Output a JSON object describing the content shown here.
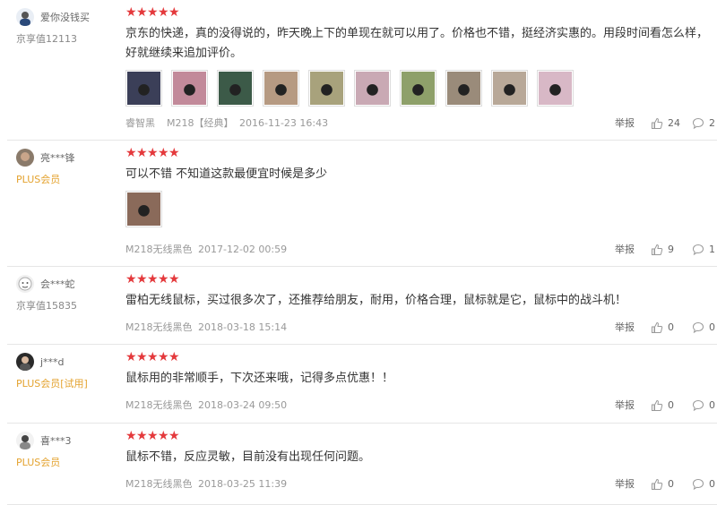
{
  "reviews": [
    {
      "username": "爱你没钱买",
      "level": "京享值12113",
      "level_type": "normal",
      "stars": 5,
      "text": "京东的快递，真的没得说的，昨天晚上下的单现在就可以用了。价格也不错，挺经济实惠的。用段时间看怎么样，好就继续来追加评价。",
      "photos": [
        "#3b3f58",
        "#c28a9a",
        "#3c5a48",
        "#b69a82",
        "#a8a27c",
        "#c9a9b4",
        "#8ea06a",
        "#9a8b7a",
        "#b8a898",
        "#d8b8c6"
      ],
      "spec_color": "睿智黑",
      "spec_model": "M218【经典】",
      "date": "2016-11-23 16:43",
      "report": "举报",
      "likes": "24",
      "comments": "2"
    },
    {
      "username": "亮***锋",
      "level": "PLUS会员",
      "level_type": "plus",
      "stars": 5,
      "text": "可以不错 不知道这款最便宜时候是多少",
      "photos": [
        "#8a6a5a"
      ],
      "spec_color": "M218无线黑色",
      "spec_model": "",
      "date": "2017-12-02 00:59",
      "report": "举报",
      "likes": "9",
      "comments": "1"
    },
    {
      "username": "会***蛇",
      "level": "京享值15835",
      "level_type": "normal",
      "stars": 5,
      "text": "雷柏无线鼠标，买过很多次了，还推荐给朋友，耐用，价格合理，鼠标就是它，鼠标中的战斗机！",
      "photos": [],
      "spec_color": "M218无线黑色",
      "spec_model": "",
      "date": "2018-03-18 15:14",
      "report": "举报",
      "likes": "0",
      "comments": "0"
    },
    {
      "username": "j***d",
      "level": "PLUS会员[试用]",
      "level_type": "plus",
      "stars": 5,
      "text": "鼠标用的非常顺手，下次还来哦，记得多点优惠！！",
      "photos": [],
      "spec_color": "M218无线黑色",
      "spec_model": "",
      "date": "2018-03-24 09:50",
      "report": "举报",
      "likes": "0",
      "comments": "0"
    },
    {
      "username": "喜***3",
      "level": "PLUS会员",
      "level_type": "plus",
      "stars": 5,
      "text": "鼠标不错，反应灵敏，目前没有出现任何问题。",
      "photos": [],
      "spec_color": "M218无线黑色",
      "spec_model": "",
      "date": "2018-03-25 11:39",
      "report": "举报",
      "likes": "0",
      "comments": "0"
    }
  ]
}
